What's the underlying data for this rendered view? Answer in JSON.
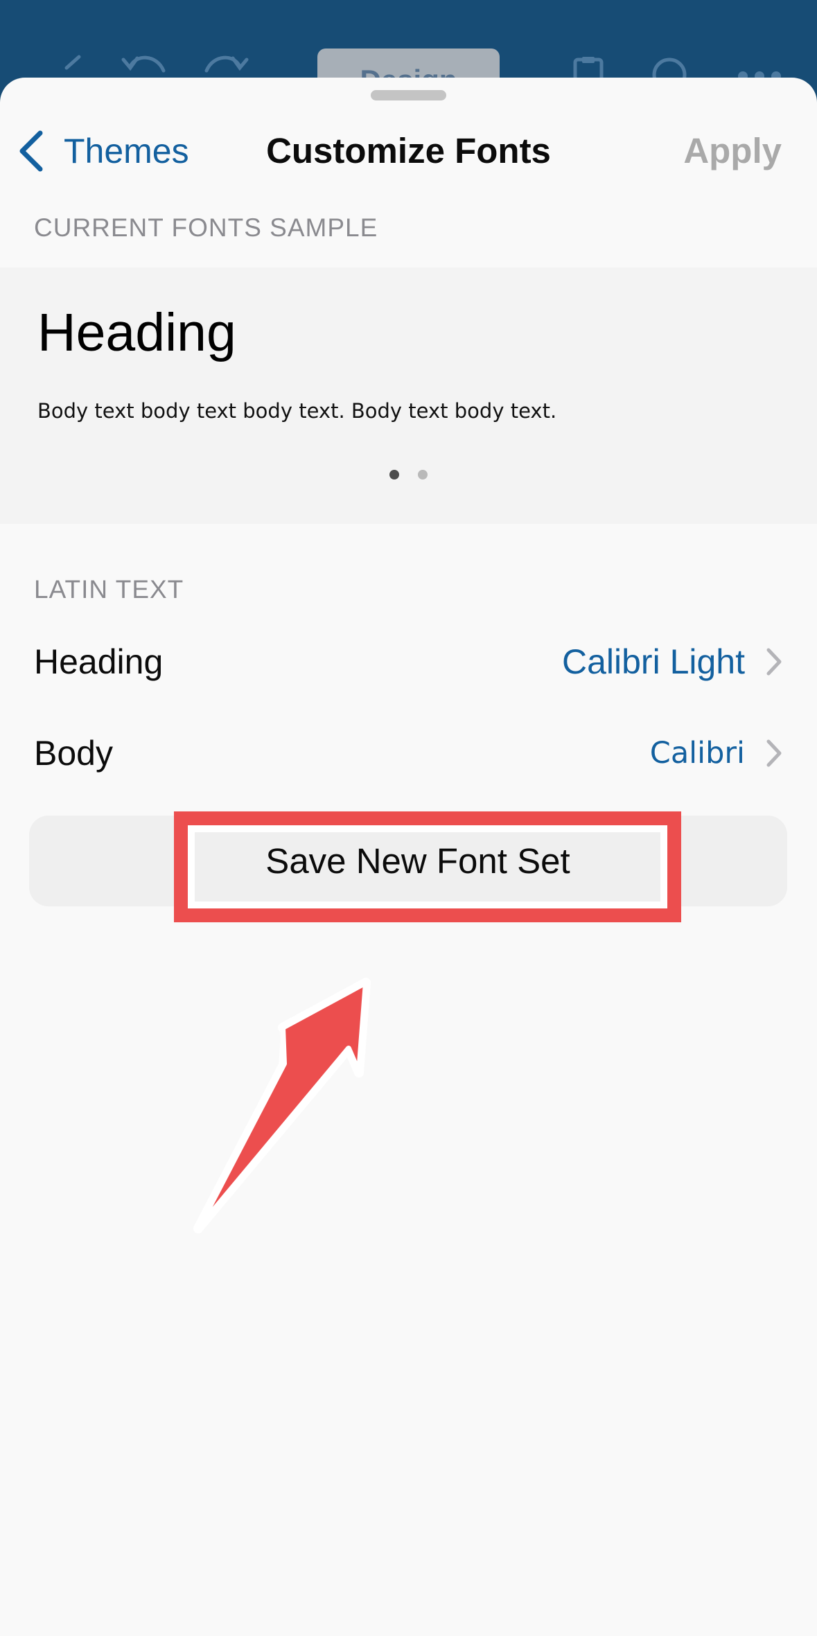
{
  "background_toolbar": {
    "design_tab_label": "Design"
  },
  "nav": {
    "back_label": "Themes",
    "title": "Customize Fonts",
    "apply_label": "Apply"
  },
  "sample": {
    "section_header": "CURRENT FONTS SAMPLE",
    "heading_text": "Heading",
    "body_text": "Body text body text body text. Body text body text.",
    "page_count": 2,
    "current_page": 1
  },
  "latin": {
    "section_header": "LATIN TEXT",
    "rows": [
      {
        "label": "Heading",
        "value": "Calibri Light"
      },
      {
        "label": "Body",
        "value": "Calibri"
      }
    ]
  },
  "save_button": {
    "label": "Save New Font Set"
  },
  "colors": {
    "accent": "#13609f",
    "toolbar": "#174c75",
    "sheet_background": "#f9f9f9",
    "annotation": "#ec4e4e",
    "disabled_text": "#a9a9a9"
  },
  "icons": {
    "back": "chevron-left-icon",
    "row_disclosure": "chevron-right-icon",
    "annotation": "arrow-pointer-icon"
  }
}
